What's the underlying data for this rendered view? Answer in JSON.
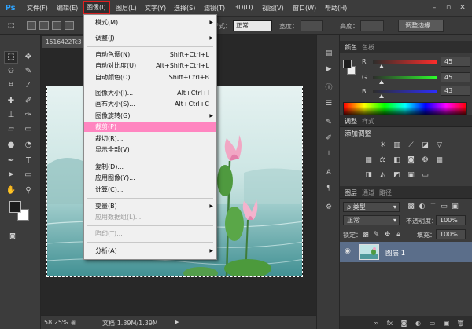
{
  "app": {
    "logo": "Ps"
  },
  "menubar": {
    "items": [
      "文件(F)",
      "编辑(E)",
      "图像(I)",
      "图层(L)",
      "文字(Y)",
      "选择(S)",
      "滤镜(T)",
      "3D(D)",
      "视图(V)",
      "窗口(W)",
      "帮助(H)"
    ],
    "active": "图像(I)",
    "window_controls": [
      "minimize-icon",
      "maximize-icon",
      "close-icon"
    ]
  },
  "options": {
    "style_label": "样式：",
    "style_value": "正常",
    "width_label": "宽度：",
    "height_label": "高度：",
    "refine_edge": "调整边缘..."
  },
  "document": {
    "tab_title": "1516422Tc3",
    "zoom": "58.25%",
    "doc_size": "文档:1.39M/1.39M"
  },
  "image_menu": {
    "items": [
      {
        "label": "模式(M)",
        "submenu": true
      },
      {
        "sep": true
      },
      {
        "label": "调整(J)",
        "submenu": true
      },
      {
        "sep": true
      },
      {
        "label": "自动色调(N)",
        "shortcut": "Shift+Ctrl+L"
      },
      {
        "label": "自动对比度(U)",
        "shortcut": "Alt+Shift+Ctrl+L"
      },
      {
        "label": "自动颜色(O)",
        "shortcut": "Shift+Ctrl+B"
      },
      {
        "sep": true
      },
      {
        "label": "图像大小(I)...",
        "shortcut": "Alt+Ctrl+I"
      },
      {
        "label": "画布大小(S)...",
        "shortcut": "Alt+Ctrl+C"
      },
      {
        "label": "图像旋转(G)",
        "submenu": true
      },
      {
        "label": "裁剪(P)",
        "highlighted": true
      },
      {
        "label": "裁切(R)..."
      },
      {
        "label": "显示全部(V)"
      },
      {
        "sep": true
      },
      {
        "label": "复制(D)..."
      },
      {
        "label": "应用图像(Y)..."
      },
      {
        "label": "计算(C)..."
      },
      {
        "sep": true
      },
      {
        "label": "变量(B)",
        "submenu": true
      },
      {
        "label": "应用数据组(L)...",
        "disabled": true
      },
      {
        "sep": true
      },
      {
        "label": "陷印(T)...",
        "disabled": true
      },
      {
        "sep": true
      },
      {
        "label": "分析(A)",
        "submenu": true
      }
    ]
  },
  "color_panel": {
    "tabs": [
      "颜色",
      "色板"
    ],
    "channels": [
      {
        "label": "R",
        "value": "45",
        "color": "#ff0000"
      },
      {
        "label": "G",
        "value": "45",
        "color": "#00c000"
      },
      {
        "label": "B",
        "value": "43",
        "color": "#0000ff"
      }
    ]
  },
  "adjustments_panel": {
    "tabs": [
      "调整",
      "样式"
    ],
    "title": "添加调整"
  },
  "layers_panel": {
    "tabs": [
      "图层",
      "通道",
      "路径"
    ],
    "filter_kind": "类型",
    "blend_mode": "正常",
    "opacity_label": "不透明度：",
    "opacity_value": "100%",
    "lock_label": "锁定：",
    "fill_label": "填充：",
    "fill_value": "100%",
    "layers": [
      {
        "name": "图层 1"
      }
    ]
  }
}
